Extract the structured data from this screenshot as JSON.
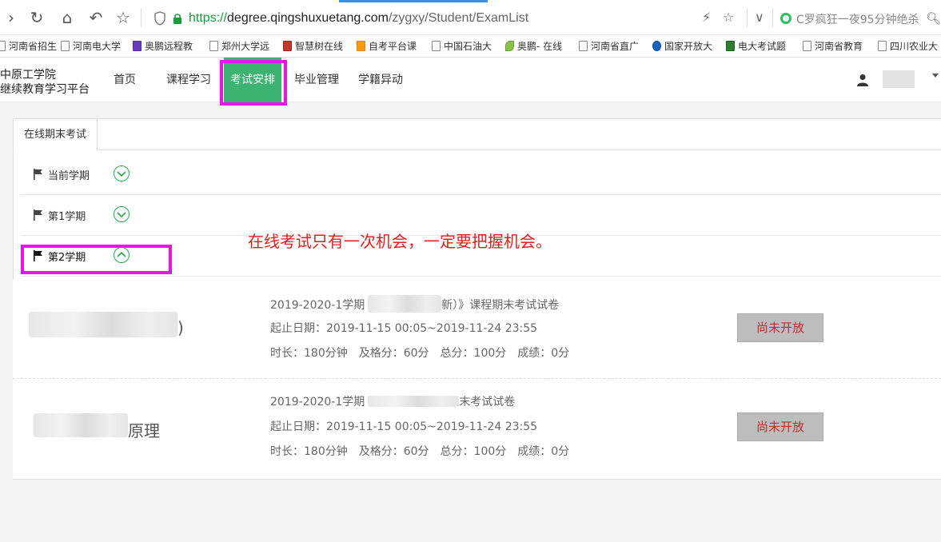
{
  "browser": {
    "url_scheme": "https://",
    "url_host": "degree.qingshuxuetang.com",
    "url_path": "/zygxy/Student/ExamList",
    "search_text": "C罗疯狂一夜95分钟绝杀",
    "colors": {
      "secure": "#1a9c3e",
      "tab_indicator": "#3a8ee6"
    }
  },
  "bookmarks": [
    {
      "label": "河南省招生"
    },
    {
      "label": "河南电大学"
    },
    {
      "label": "奥鹏远程教"
    },
    {
      "label": "郑州大学远"
    },
    {
      "label": "智慧树在线"
    },
    {
      "label": "自考平台课"
    },
    {
      "label": "中国石油大"
    },
    {
      "label": "奥鹏- 在线"
    },
    {
      "label": "河南省直广"
    },
    {
      "label": "国家开放大"
    },
    {
      "label": "电大考试题"
    },
    {
      "label": "河南省教育"
    },
    {
      "label": "四川农业大"
    }
  ],
  "site": {
    "logo_line1": "中原工学院",
    "logo_line2": "继续教育学习平台",
    "menu": [
      {
        "label": "首页"
      },
      {
        "label": "课程学习"
      },
      {
        "label": "考试安排",
        "active": true
      },
      {
        "label": "毕业管理"
      },
      {
        "label": "学籍异动"
      }
    ],
    "colors": {
      "active_menu": "#3cb371",
      "highlight": "#ee11ee"
    }
  },
  "tab": {
    "label": "在线期末考试"
  },
  "terms": [
    {
      "label": "当前学期",
      "expanded": false
    },
    {
      "label": "第1学期",
      "expanded": false
    },
    {
      "label": "第2学期",
      "expanded": true
    }
  ],
  "annotation": "在线考试只有一次机会，一定要把握机会。",
  "exams": [
    {
      "course_visible": ")",
      "title_prefix": "2019-2020-1学期",
      "title_suffix": "新）》课程期末考试试卷",
      "dates": "起止日期：2019-11-15 00:05~2019-11-24 23:55",
      "stats": "时长：180分钟　及格分：60分　总分：100分　成绩：0分",
      "button": "尚未开放"
    },
    {
      "course_visible": "原理",
      "title_prefix": "2019-2020-1学期",
      "title_suffix": "末考试试卷",
      "dates": "起止日期：2019-11-15 00:05~2019-11-24 23:55",
      "stats": "时长：180分钟　及格分：60分　总分：100分　成绩：0分",
      "button": "尚未开放"
    }
  ]
}
